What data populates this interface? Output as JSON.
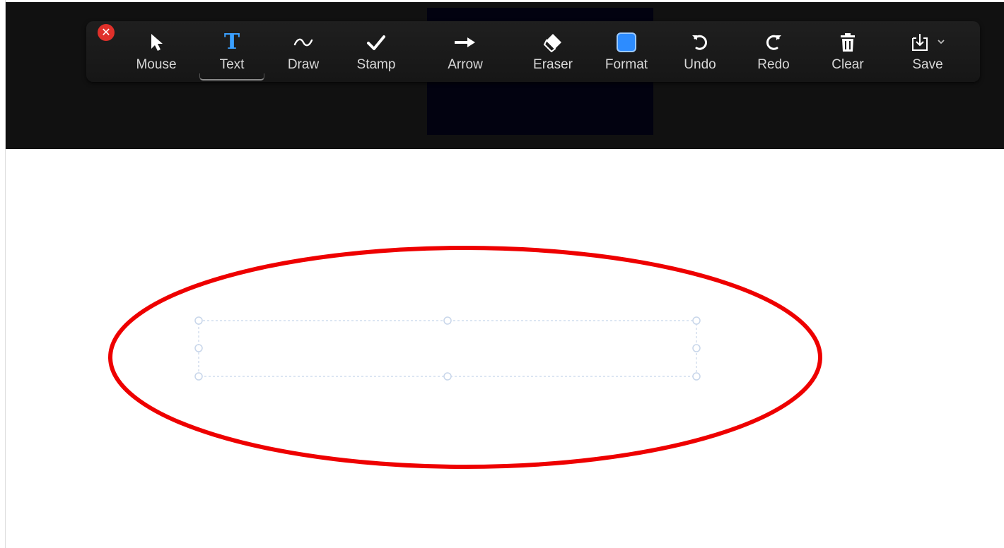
{
  "toolbar": {
    "close_icon": "close-x-icon",
    "tools": [
      {
        "id": "mouse",
        "label": "Mouse",
        "icon": "cursor-arrow-icon",
        "active": false
      },
      {
        "id": "text",
        "label": "Text",
        "icon": "text-T-icon",
        "active": true
      },
      {
        "id": "draw",
        "label": "Draw",
        "icon": "squiggle-icon",
        "active": false
      },
      {
        "id": "stamp",
        "label": "Stamp",
        "icon": "checkmark-icon",
        "active": false
      },
      {
        "id": "arrow",
        "label": "Arrow",
        "icon": "right-arrow-icon",
        "active": false
      },
      {
        "id": "eraser",
        "label": "Eraser",
        "icon": "eraser-icon",
        "active": false
      },
      {
        "id": "format",
        "label": "Format",
        "icon": "color-swatch-icon",
        "active": false
      },
      {
        "id": "undo",
        "label": "Undo",
        "icon": "undo-icon",
        "active": false
      },
      {
        "id": "redo",
        "label": "Redo",
        "icon": "redo-icon",
        "active": false
      },
      {
        "id": "clear",
        "label": "Clear",
        "icon": "trash-icon",
        "active": false
      },
      {
        "id": "save",
        "label": "Save",
        "icon": "save-download-icon",
        "active": false
      }
    ],
    "text_glyph": "T",
    "save_menu_icon": "chevron-down-icon"
  },
  "colors": {
    "header_bg": "#111111",
    "toolbar_bg": "#1b1b1b",
    "active_tool": "#3aa0ff",
    "format_color": "#2d8cff",
    "close_button": "#e0302a",
    "highlight_ellipse": "#ee0000",
    "text_box_guides": "#c8d6ea"
  },
  "canvas": {
    "text_box_value": ""
  }
}
